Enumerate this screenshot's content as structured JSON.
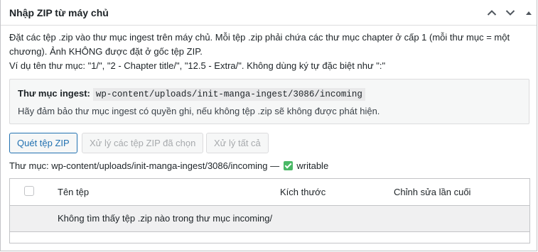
{
  "panel": {
    "title": "Nhập ZIP từ máy chủ",
    "controls": {
      "move_up": "chevron-up-icon",
      "move_down": "chevron-down-icon",
      "toggle": "caret-up-icon"
    }
  },
  "description": {
    "line1": "Đặt các tệp .zip vào thư mục ingest trên máy chủ. Mỗi tệp .zip phải chứa các thư mục chapter ở cấp 1 (mỗi thư mục = một",
    "line2": "chương). Ảnh KHÔNG được đặt ở gốc tệp ZIP.",
    "line3": "Ví dụ tên thư mục: \"1/\", \"2 - Chapter title/\", \"12.5 - Extra/\". Không dùng ký tự đặc biệt như \":\""
  },
  "notice": {
    "label": "Thư mục ingest:",
    "path": "wp-content/uploads/init-manga-ingest/3086/incoming",
    "hint": "Hãy đảm bảo thư mục ingest có quyền ghi, nếu không tệp .zip sẽ không được phát hiện."
  },
  "buttons": {
    "scan": "Quét tệp ZIP",
    "process_selected": "Xử lý các tệp ZIP đã chọn",
    "process_all": "Xử lý tất cả"
  },
  "status": {
    "prefix": "Thư mục: wp-content/uploads/init-manga-ingest/3086/incoming —",
    "state": "writable",
    "state_color": "#4ab866"
  },
  "table": {
    "columns": [
      "Tên tệp",
      "Kích thước",
      "Chỉnh sửa lần cuối"
    ],
    "empty_message": "Không tìm thấy tệp .zip nào trong thư mục incoming/"
  }
}
